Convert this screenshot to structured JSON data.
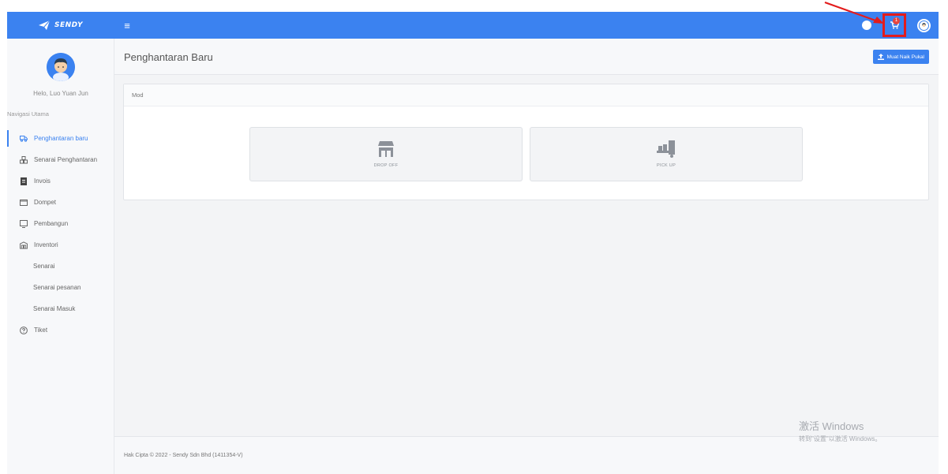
{
  "topbar": {
    "brand": "SENDY",
    "cart_badge": "1",
    "colors": {
      "bar": "#3b82f0",
      "highlight": "#e31c1c"
    }
  },
  "sidebar": {
    "greeting": "Helo, Luo Yuan Jun",
    "nav_heading": "Navigasi Utama",
    "items": [
      {
        "label": "Penghantaran baru",
        "icon": "truck-icon",
        "active": true
      },
      {
        "label": "Senarai Penghantaran",
        "icon": "boxes-icon"
      },
      {
        "label": "Invois",
        "icon": "invoice-icon"
      },
      {
        "label": "Dompet",
        "icon": "wallet-icon"
      },
      {
        "label": "Pembangun",
        "icon": "monitor-icon"
      },
      {
        "label": "Inventori",
        "icon": "warehouse-icon"
      },
      {
        "label": "Senarai",
        "sub": true
      },
      {
        "label": "Senarai pesanan",
        "sub": true
      },
      {
        "label": "Senarai Masuk",
        "sub": true
      },
      {
        "label": "Tiket",
        "icon": "help-circle-icon"
      }
    ]
  },
  "main": {
    "title": "Penghantaran Baru",
    "import_button": "Muat Naik Pukal",
    "card_header": "Mod",
    "modes": [
      {
        "label": "DROP OFF",
        "icon": "store-icon"
      },
      {
        "label": "PICK UP",
        "icon": "hand-truck-icon"
      }
    ]
  },
  "footer": {
    "copyright": "Hak Cipta © 2022 - Sendy Sdn Bhd (1411354-V)"
  },
  "watermark": {
    "line1": "激活 Windows",
    "line2": "转到\"设置\"以激活 Windows。"
  }
}
